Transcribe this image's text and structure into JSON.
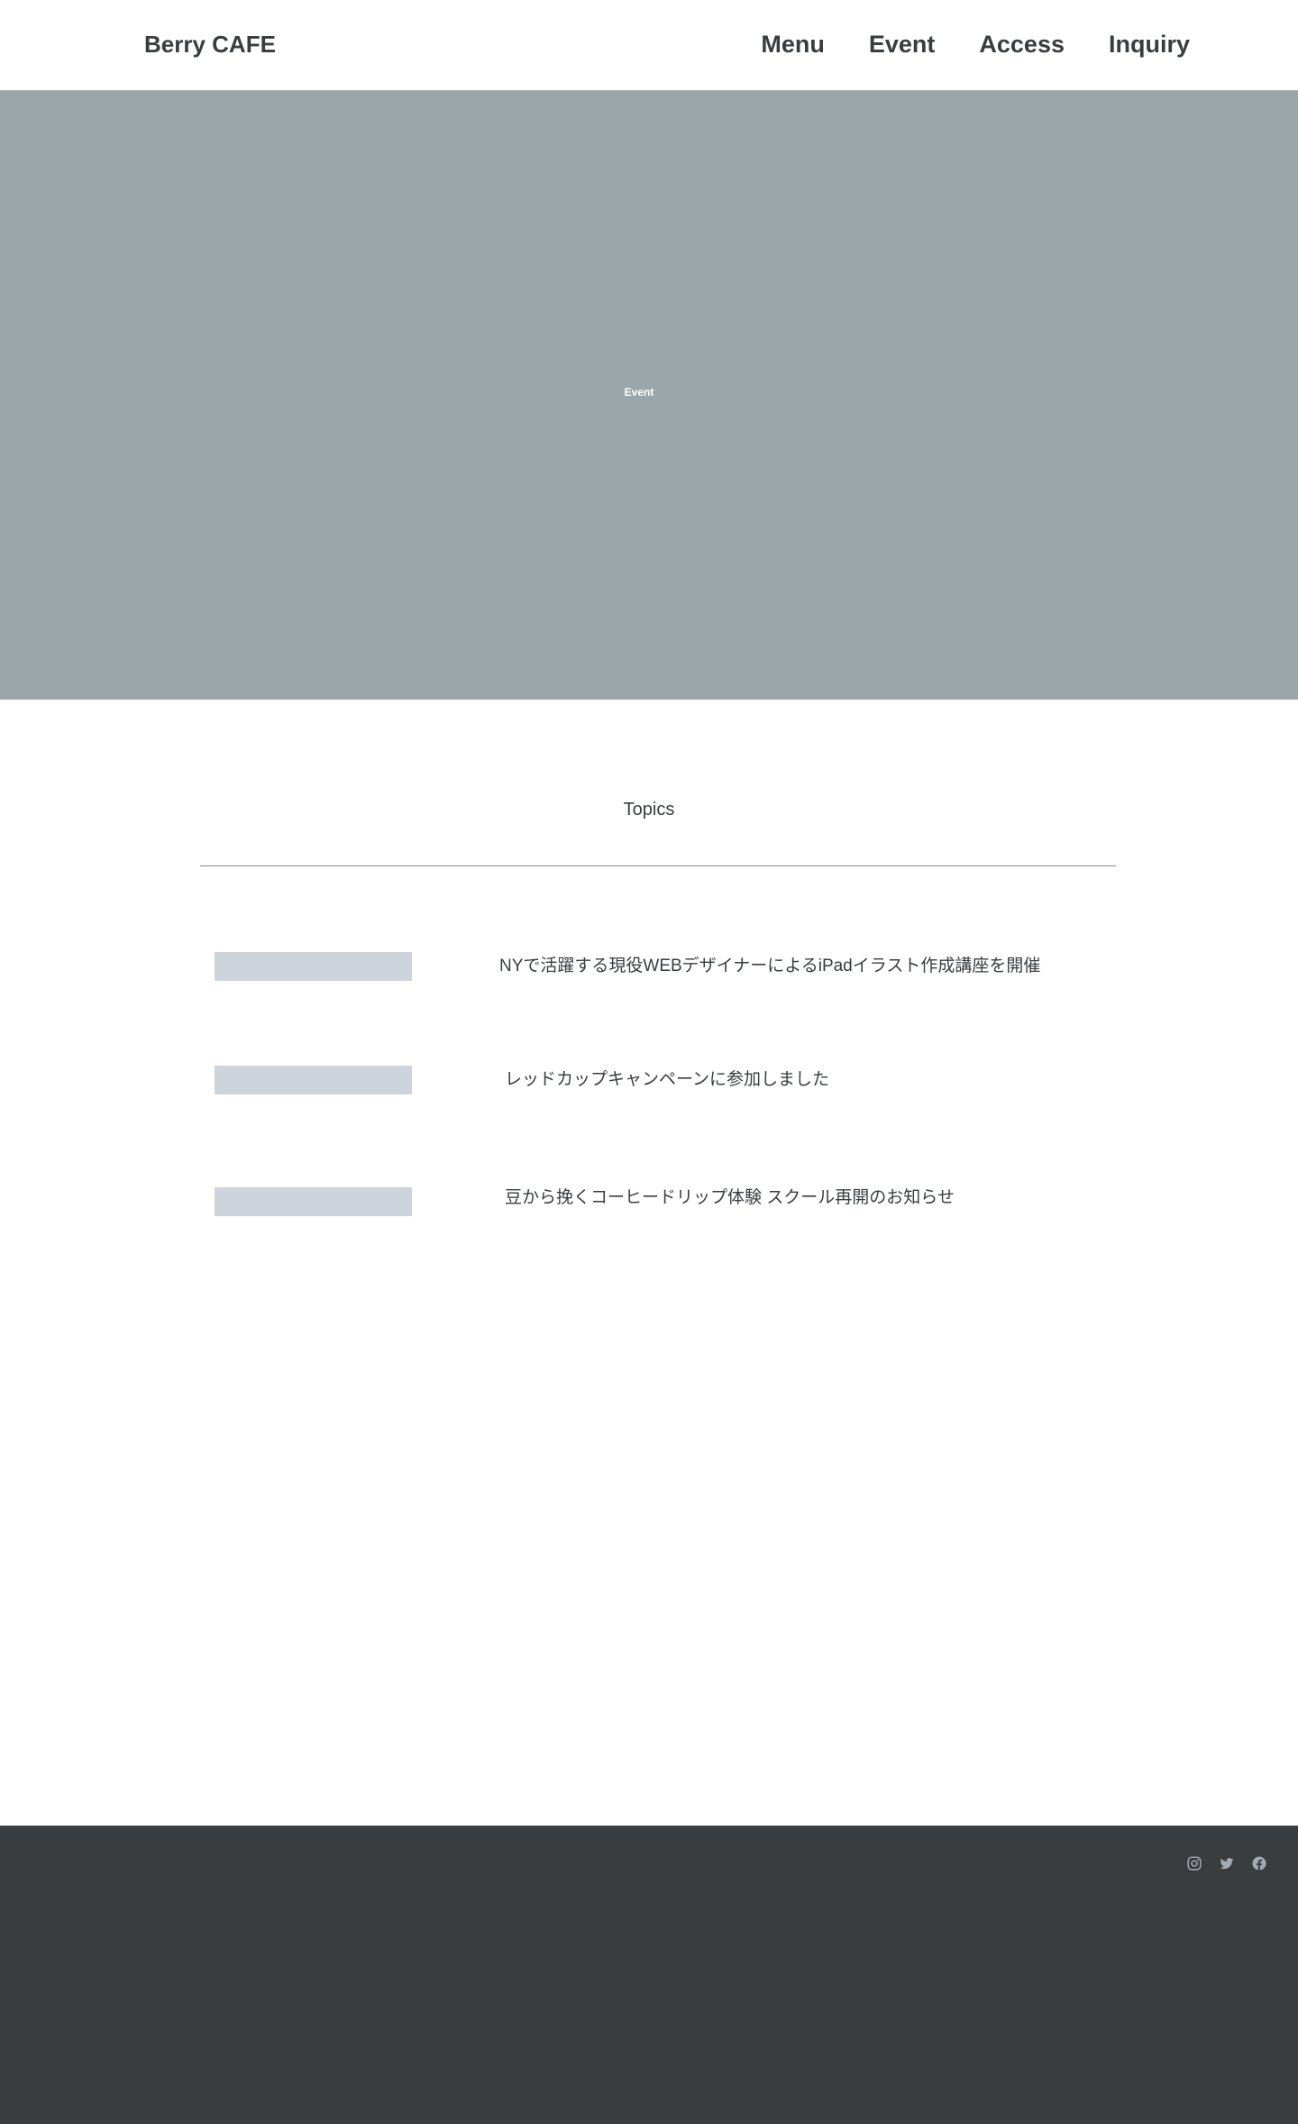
{
  "header": {
    "logo": "Berry CAFE",
    "nav": {
      "menu": "Menu",
      "event": "Event",
      "access": "Access",
      "inquiry": "Inquiry"
    }
  },
  "hero": {
    "label": "Event",
    "background_color": "#9ba6ab"
  },
  "topics": {
    "title": "Topics",
    "items": [
      {
        "text": "NYで活躍する現役WEBデザイナーによるiPadイラスト作成講座を開催"
      },
      {
        "text": "レッドカップキャンペーンに参加しました"
      },
      {
        "text": "豆から挽くコーヒードリップ体験 スクール再開のお知らせ"
      }
    ]
  },
  "footer": {
    "background_color": "#393d40",
    "social_icons": [
      "instagram-icon",
      "twitter-icon",
      "facebook-icon"
    ]
  }
}
